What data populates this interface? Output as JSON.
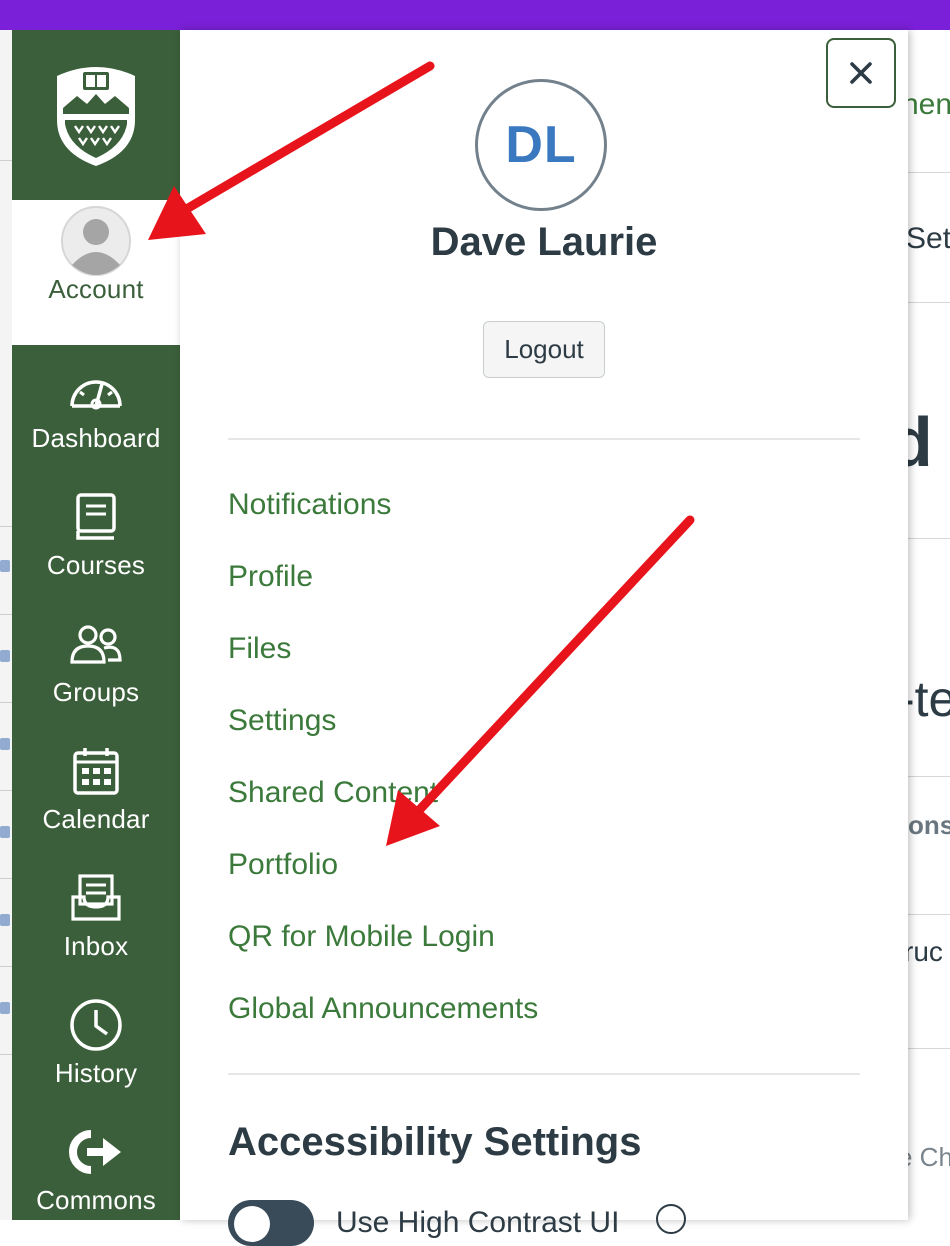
{
  "nav": {
    "items": [
      {
        "label": "Account",
        "icon": "user-avatar-icon"
      },
      {
        "label": "Dashboard",
        "icon": "speedometer-icon"
      },
      {
        "label": "Courses",
        "icon": "book-icon"
      },
      {
        "label": "Groups",
        "icon": "people-icon"
      },
      {
        "label": "Calendar",
        "icon": "calendar-icon"
      },
      {
        "label": "Inbox",
        "icon": "inbox-icon"
      },
      {
        "label": "History",
        "icon": "clock-icon"
      },
      {
        "label": "Commons",
        "icon": "commons-icon"
      }
    ],
    "logo": "shield-logo-icon"
  },
  "tray": {
    "avatar_initials": "DL",
    "user_name": "Dave Laurie",
    "logout_label": "Logout",
    "close_label": "×",
    "links": [
      "Notifications",
      "Profile",
      "Files",
      "Settings",
      "Shared Content",
      "Portfolio",
      "QR for Mobile Login",
      "Global Announcements"
    ],
    "accessibility_title": "Accessibility Settings",
    "high_contrast_label": "Use High Contrast UI"
  },
  "background": {
    "snippets": [
      "nen",
      "Set",
      "d",
      "-te",
      "ons",
      "ruc",
      "e Ch"
    ]
  },
  "colors": {
    "nav_bg": "#3b5f3b",
    "link": "#3b7a3b",
    "accent_purple": "#7a20d8",
    "avatar_text": "#3a78c0",
    "arrow": "#e8141c"
  }
}
